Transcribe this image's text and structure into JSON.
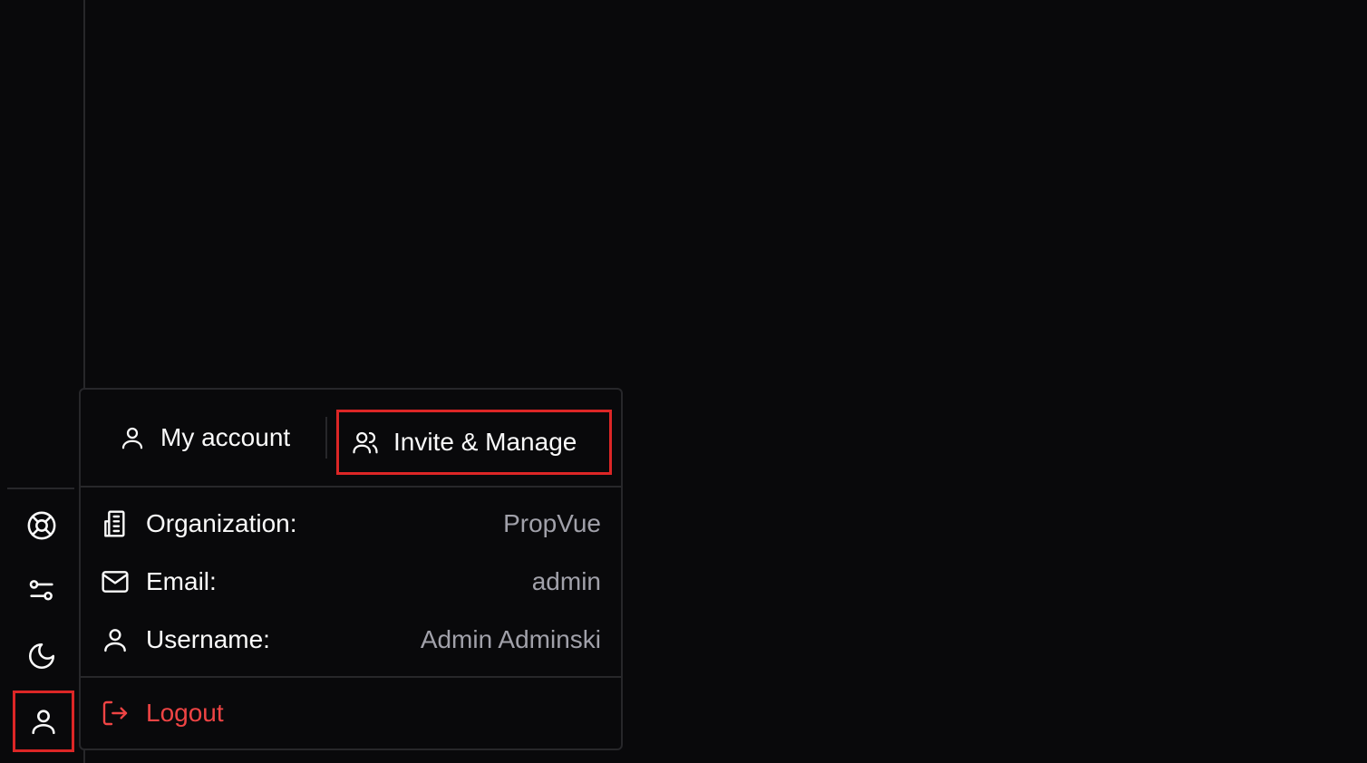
{
  "sidebar": {
    "buttons": [
      {
        "name": "help",
        "icon": "life-buoy-icon"
      },
      {
        "name": "settings",
        "icon": "sliders-icon"
      },
      {
        "name": "theme",
        "icon": "moon-icon"
      },
      {
        "name": "account",
        "icon": "user-icon",
        "active": true
      }
    ]
  },
  "account_menu": {
    "tabs": {
      "my_account": "My account",
      "invite_manage": "Invite & Manage"
    },
    "info": {
      "organization_label": "Organization:",
      "organization_value": "PropVue",
      "email_label": "Email:",
      "email_value": "admin",
      "username_label": "Username:",
      "username_value": "Admin Adminski"
    },
    "logout_label": "Logout"
  },
  "colors": {
    "background": "#09090b",
    "border": "#27272a",
    "text": "#fafafa",
    "muted": "#a1a1aa",
    "danger": "#ef4444",
    "highlight": "#dc2626"
  }
}
